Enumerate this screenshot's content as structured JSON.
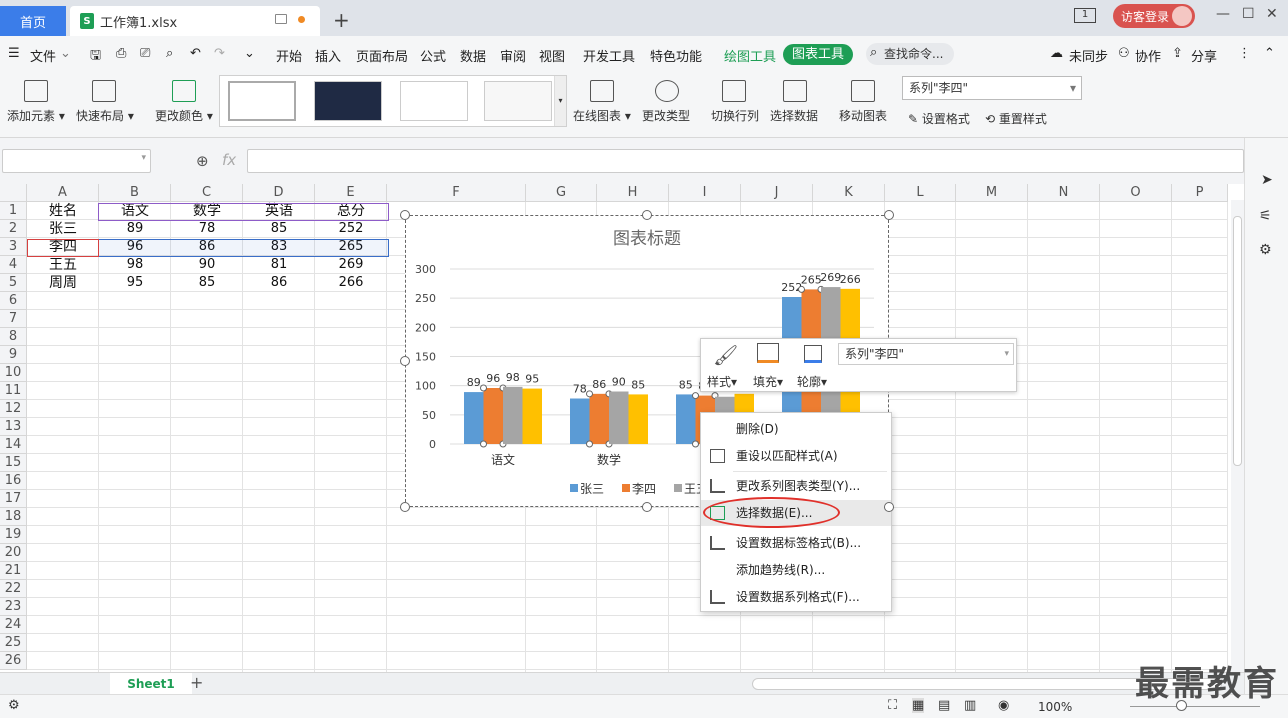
{
  "tabs": {
    "home": "首页",
    "file": "工作簿1.xlsx"
  },
  "title_right": {
    "badge": "1",
    "login": "访客登录"
  },
  "menu": {
    "file": "文件",
    "items": [
      "开始",
      "插入",
      "页面布局",
      "公式",
      "数据",
      "审阅",
      "视图",
      "开发工具",
      "特色功能"
    ],
    "draw_tool": "绘图工具",
    "chart_tool": "图表工具",
    "search": "查找命令...",
    "sync": "未同步",
    "collab": "协作",
    "share": "分享"
  },
  "toolbar": {
    "add_element": "添加元素",
    "quick_layout": "快速布局",
    "change_color": "更改颜色",
    "online_chart": "在线图表",
    "change_type": "更改类型",
    "switch_rowcol": "切换行列",
    "select_data": "选择数据",
    "move_chart": "移动图表",
    "series_select": "系列\"李四\"",
    "set_format": "设置格式",
    "reset_style": "重置样式"
  },
  "formula": {
    "fx": "fx"
  },
  "columns": [
    "A",
    "B",
    "C",
    "D",
    "E",
    "F",
    "G",
    "H",
    "I",
    "J",
    "K",
    "L",
    "M",
    "N",
    "O",
    "P"
  ],
  "rows": [
    "1",
    "2",
    "3",
    "4",
    "5",
    "6",
    "7",
    "8",
    "9",
    "10",
    "11",
    "12",
    "13",
    "14",
    "15",
    "16",
    "17",
    "18",
    "19",
    "20",
    "21",
    "22",
    "23",
    "24",
    "25",
    "26"
  ],
  "table": {
    "header": [
      "姓名",
      "语文",
      "数学",
      "英语",
      "总分"
    ],
    "data": [
      [
        "张三",
        "89",
        "78",
        "85",
        "252"
      ],
      [
        "李四",
        "96",
        "86",
        "83",
        "265"
      ],
      [
        "王五",
        "98",
        "90",
        "81",
        "269"
      ],
      [
        "周周",
        "95",
        "85",
        "86",
        "266"
      ]
    ]
  },
  "chart_data": {
    "type": "bar",
    "title": "图表标题",
    "categories": [
      "语文",
      "数学",
      "英语",
      "总分"
    ],
    "series": [
      {
        "name": "张三",
        "values": [
          89,
          78,
          85,
          252
        ],
        "color": "#5b9bd5"
      },
      {
        "name": "李四",
        "values": [
          96,
          86,
          83,
          265
        ],
        "color": "#ed7d31"
      },
      {
        "name": "王五",
        "values": [
          98,
          90,
          81,
          269
        ],
        "color": "#a5a5a5"
      },
      {
        "name": "周周",
        "values": [
          95,
          85,
          86,
          266
        ],
        "color": "#ffc000"
      }
    ],
    "ylim": [
      0,
      300
    ],
    "yticks": [
      "0",
      "50",
      "100",
      "150",
      "200",
      "250",
      "300"
    ],
    "grid": true,
    "legend": "bottom"
  },
  "popup": {
    "style": "样式",
    "fill": "填充",
    "outline": "轮廓",
    "series": "系列\"李四\""
  },
  "context_menu": [
    "删除(D)",
    "重设以匹配样式(A)",
    "更改系列图表类型(Y)...",
    "选择数据(E)...",
    "设置数据标签格式(B)...",
    "添加趋势线(R)...",
    "设置数据系列格式(F)..."
  ],
  "sheet": {
    "name": "Sheet1"
  },
  "status": {
    "zoom": "100%"
  },
  "watermark": "最需教育"
}
